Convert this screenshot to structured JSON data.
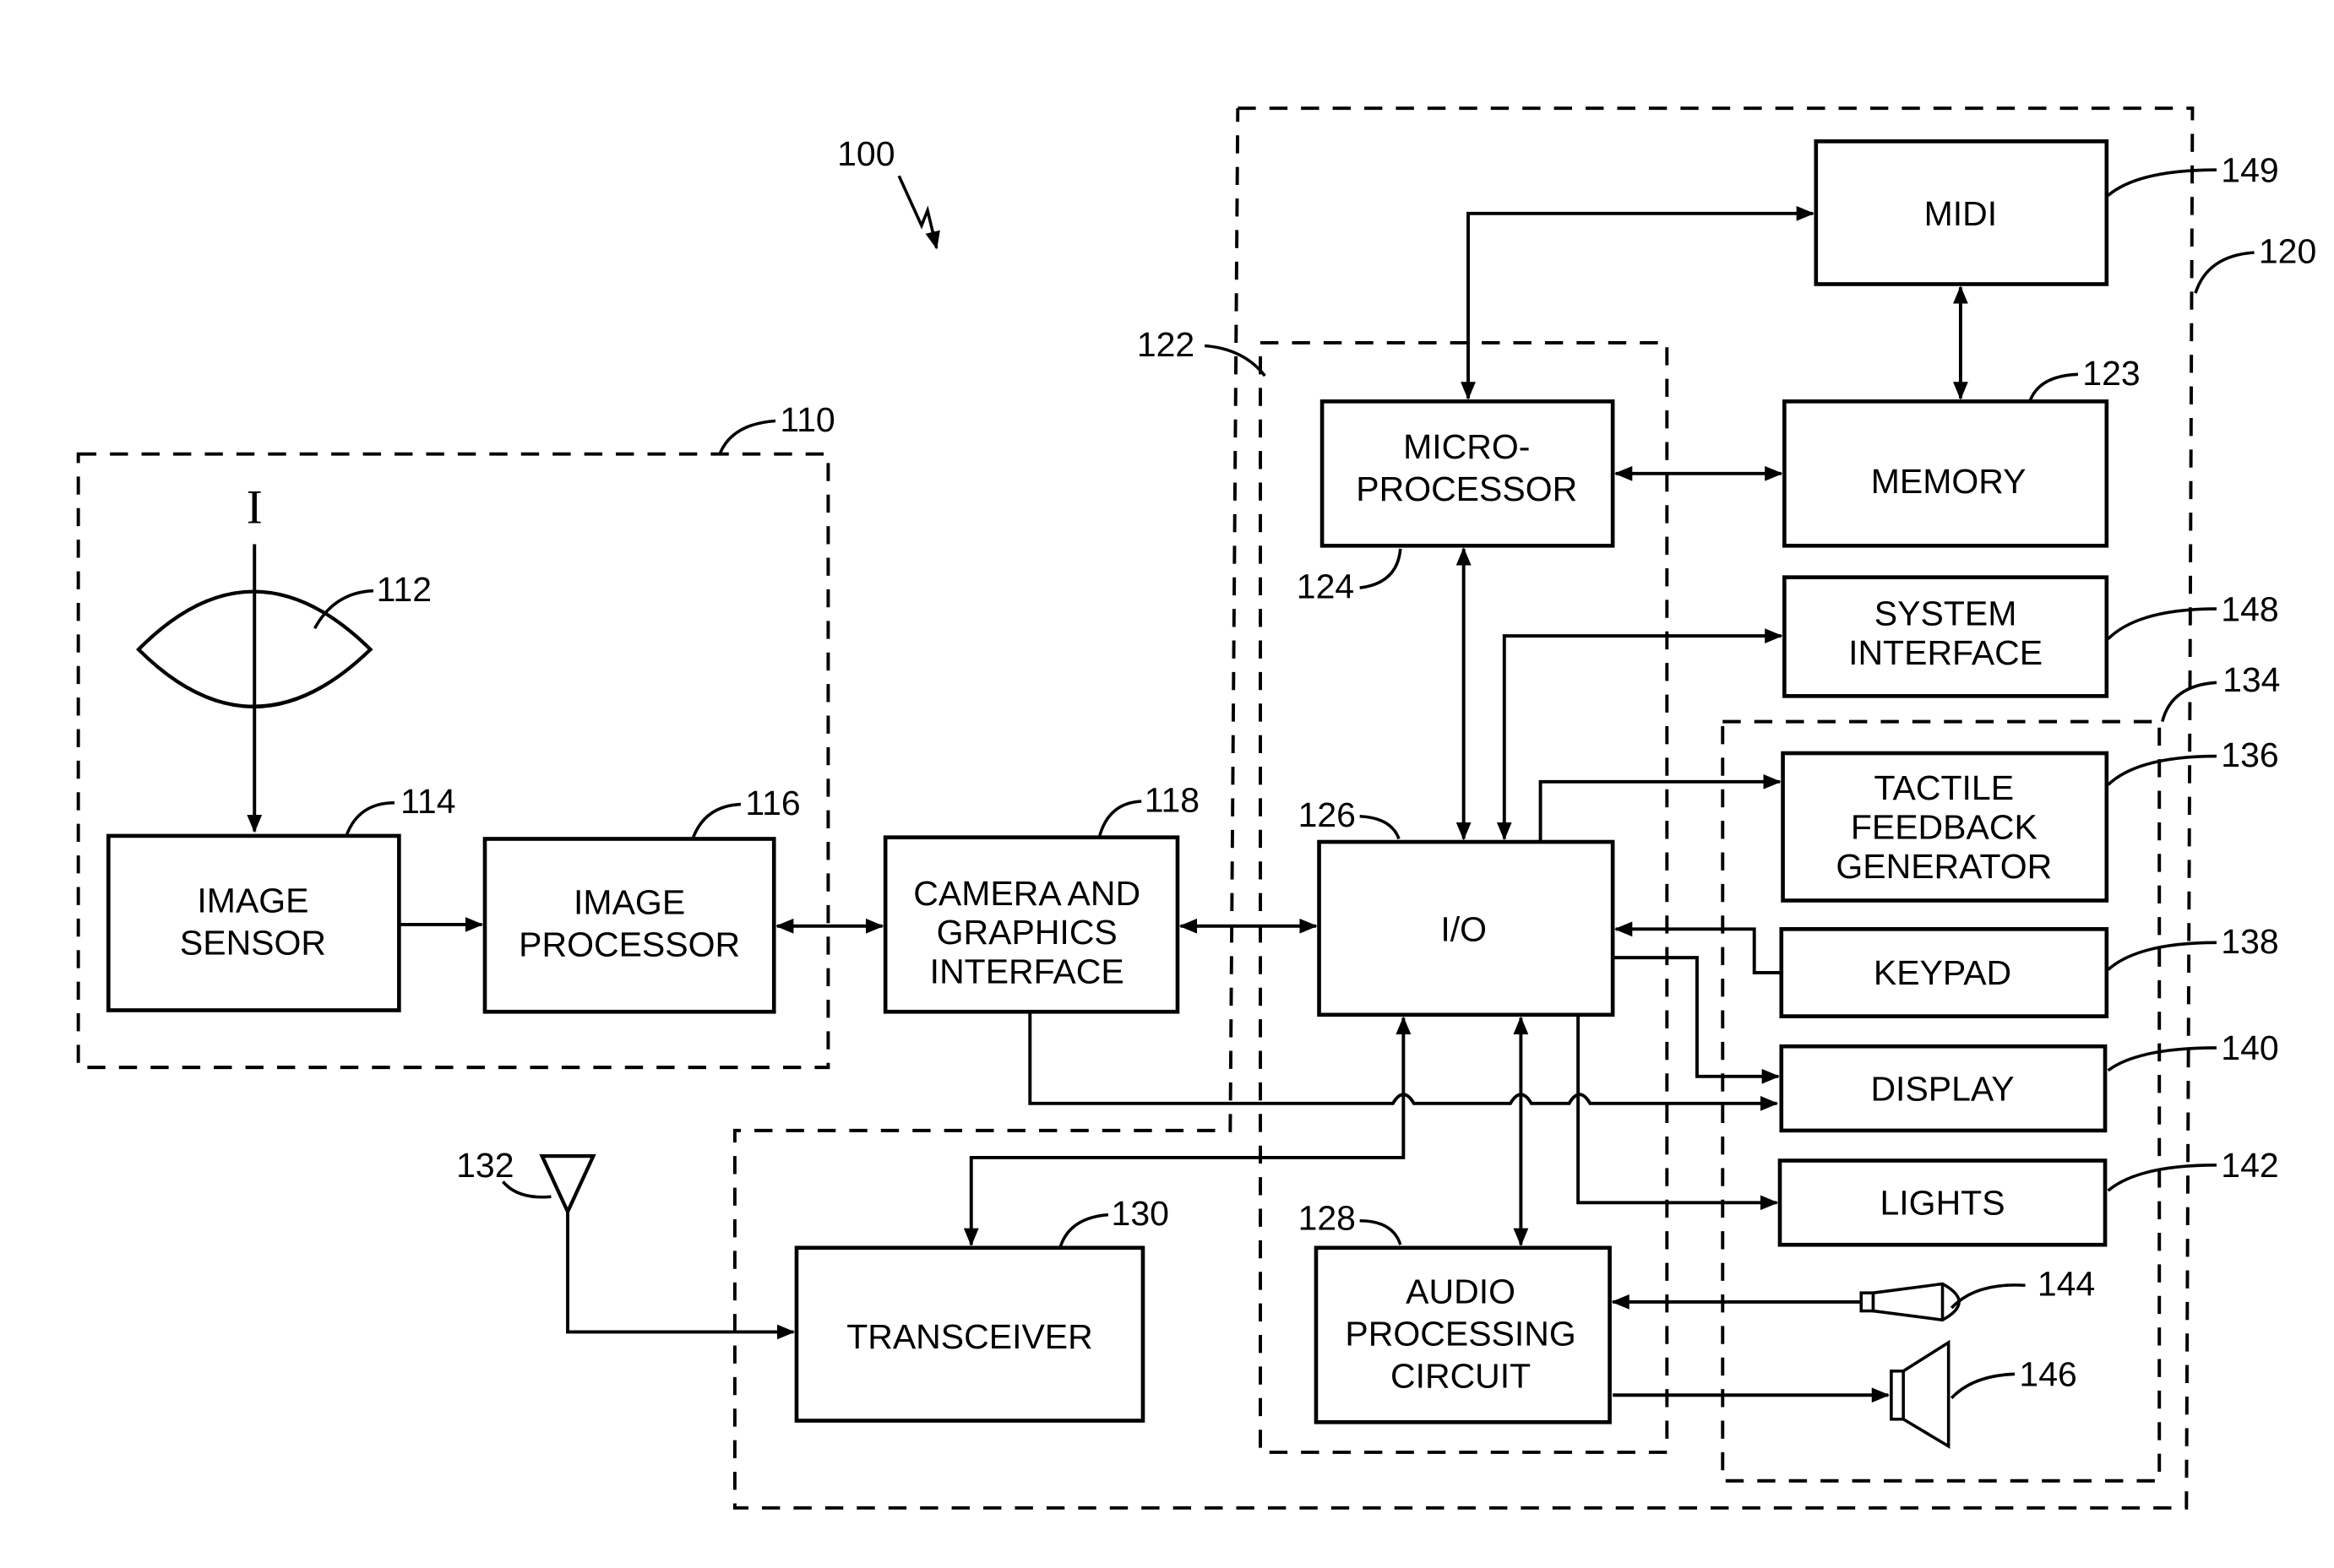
{
  "figure": {
    "reference": "100",
    "input_symbol": "I"
  },
  "groups": {
    "camera_module": "110",
    "handset": "120",
    "controller": "122",
    "ui_module": "134"
  },
  "blocks": {
    "lens": {
      "ref": "112"
    },
    "image_sensor": {
      "ref": "114",
      "lines": [
        "IMAGE",
        "SENSOR"
      ]
    },
    "image_processor": {
      "ref": "116",
      "lines": [
        "IMAGE",
        "PROCESSOR"
      ]
    },
    "camera_interface": {
      "ref": "118",
      "lines": [
        "CAMERA AND",
        "GRAPHICS",
        "INTERFACE"
      ]
    },
    "midi": {
      "ref": "149",
      "lines": [
        "MIDI"
      ]
    },
    "memory": {
      "ref": "123",
      "lines": [
        "MEMORY"
      ]
    },
    "microprocessor": {
      "ref": "124",
      "lines": [
        "MICRO-",
        "PROCESSOR"
      ]
    },
    "system_interface": {
      "ref": "148",
      "lines": [
        "SYSTEM",
        "INTERFACE"
      ]
    },
    "io": {
      "ref": "126",
      "lines": [
        "I/O"
      ]
    },
    "tactile": {
      "ref": "136",
      "lines": [
        "TACTILE",
        "FEEDBACK",
        "GENERATOR"
      ]
    },
    "keypad": {
      "ref": "138",
      "lines": [
        "KEYPAD"
      ]
    },
    "display": {
      "ref": "140",
      "lines": [
        "DISPLAY"
      ]
    },
    "lights": {
      "ref": "142",
      "lines": [
        "LIGHTS"
      ]
    },
    "microphone": {
      "ref": "144"
    },
    "speaker": {
      "ref": "146"
    },
    "audio": {
      "ref": "128",
      "lines": [
        "AUDIO",
        "PROCESSING",
        "CIRCUIT"
      ]
    },
    "transceiver": {
      "ref": "130",
      "lines": [
        "TRANSCEIVER"
      ]
    },
    "antenna": {
      "ref": "132"
    }
  }
}
